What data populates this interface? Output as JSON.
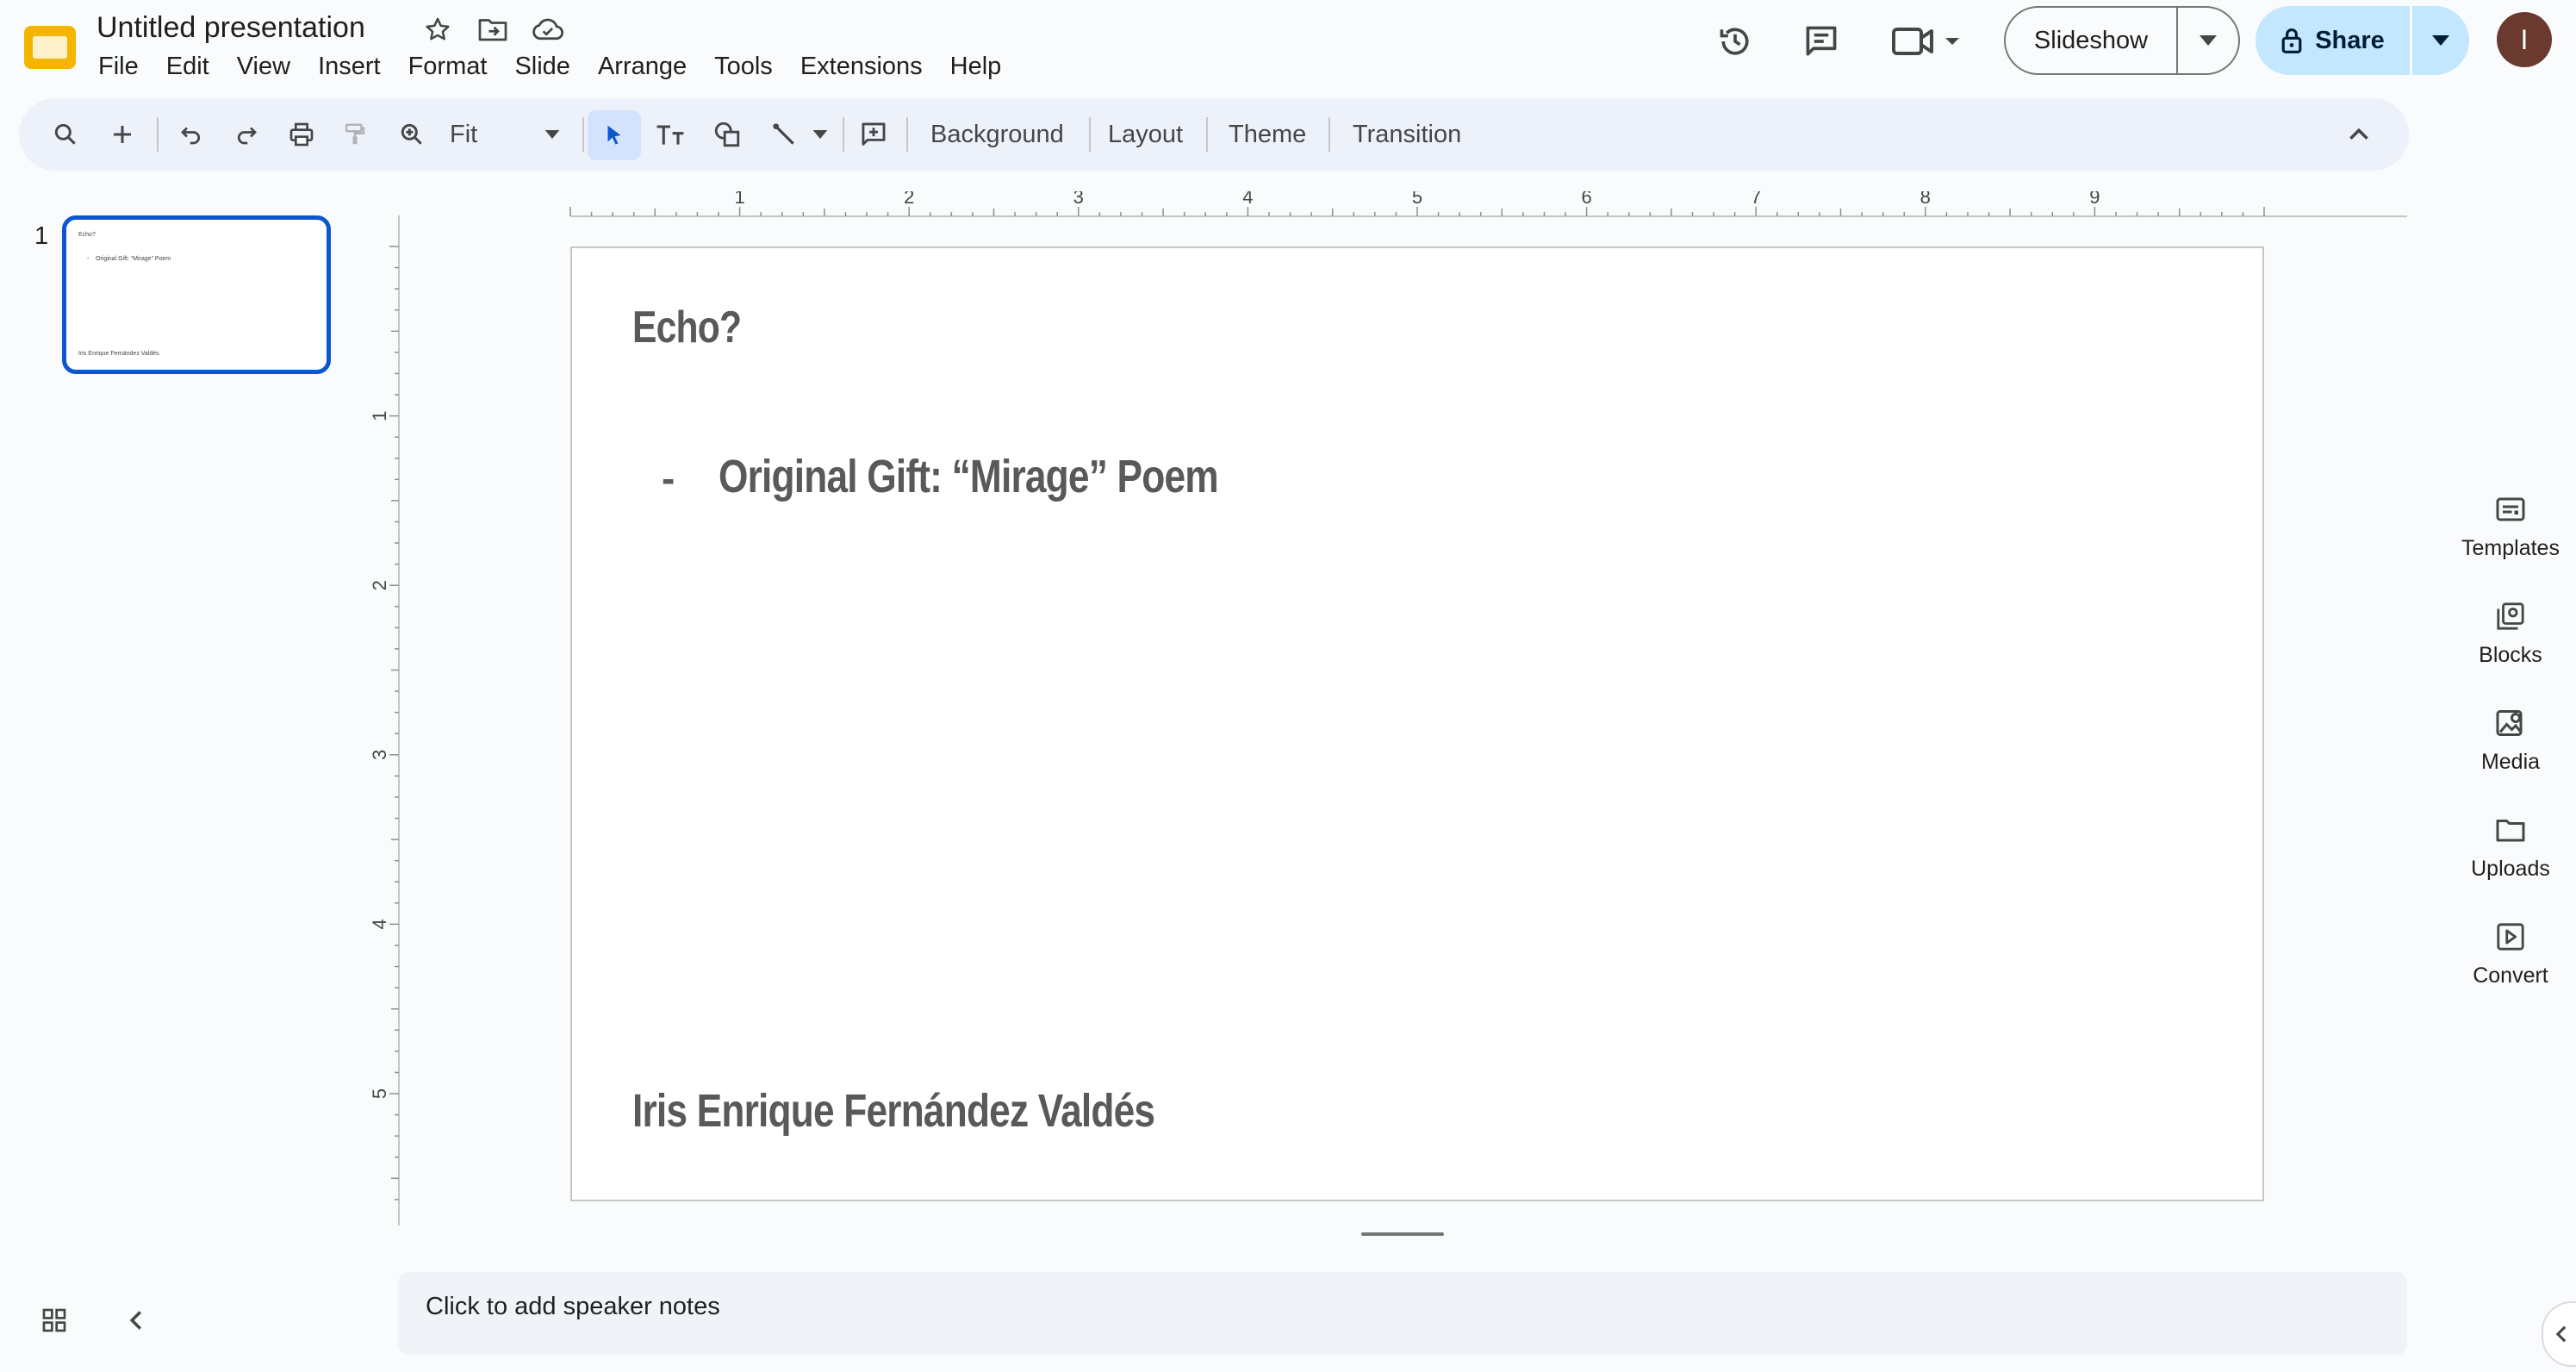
{
  "app": {
    "document_title": "Untitled presentation",
    "icons": [
      "slides-logo-icon",
      "star-icon",
      "move-to-folder-icon",
      "cloud-saved-icon"
    ]
  },
  "menu": {
    "items": [
      "File",
      "Edit",
      "View",
      "Insert",
      "Format",
      "Slide",
      "Arrange",
      "Tools",
      "Extensions",
      "Help"
    ]
  },
  "header": {
    "slideshow_label": "Slideshow",
    "share_label": "Share",
    "avatar_initial": "I",
    "accent_color": "#c2e7ff"
  },
  "toolbar": {
    "zoom_label": "Fit",
    "background_label": "Background",
    "layout_label": "Layout",
    "theme_label": "Theme",
    "transition_label": "Transition"
  },
  "rulers": {
    "horizontal_ticks": [
      "1",
      "2",
      "3",
      "4",
      "5",
      "6",
      "7",
      "8",
      "9"
    ],
    "vertical_ticks": [
      "1",
      "2",
      "3",
      "4",
      "5"
    ]
  },
  "filmstrip": {
    "slide_number": "1",
    "selected_color": "#0b57d0"
  },
  "slide": {
    "title": "Echo?",
    "bullet_dash": "-",
    "bullet_text": "Original Gift: “Mirage” Poem",
    "author": "Iris Enrique Fernández Valdés"
  },
  "notes": {
    "placeholder": "Click to add speaker notes"
  },
  "side_panel": {
    "items": [
      "Templates",
      "Blocks",
      "Media",
      "Uploads",
      "Convert"
    ]
  }
}
